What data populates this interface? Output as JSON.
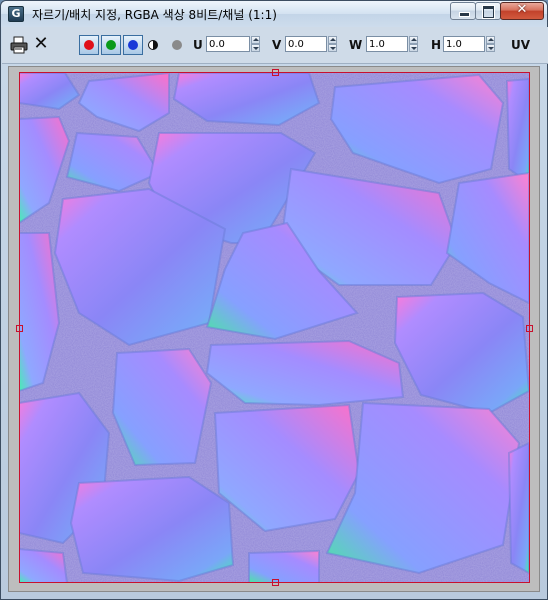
{
  "window": {
    "title": "자르기/배치 지정, RGBA 색상 8비트/채널 (1:1)",
    "app_icon_glyph": "G",
    "controls": {
      "minimize_icon": "minimize-icon",
      "maximize_icon": "maximize-icon",
      "close_icon": "close-icon",
      "close_glyph": "✕"
    }
  },
  "toolbar": {
    "print_icon": "print-icon",
    "clear_glyph": "✕",
    "channels": [
      {
        "name": "red-channel",
        "color": "#e0101a",
        "active": true
      },
      {
        "name": "green-channel",
        "color": "#0a9a1a",
        "active": true
      },
      {
        "name": "blue-channel",
        "color": "#1838d8",
        "active": true
      }
    ],
    "alpha_icon": "alpha-channel-icon",
    "mono_icon": "monochrome-icon",
    "u": {
      "label": "U",
      "value": "0.0"
    },
    "v": {
      "label": "V",
      "value": "0.0"
    },
    "w": {
      "label": "W",
      "value": "1.0"
    },
    "h": {
      "label": "H",
      "value": "1.0"
    },
    "uv_label": "UV"
  },
  "image": {
    "description_colors": {
      "base": "#8f86d6",
      "crop_frame": "#c8102e"
    }
  }
}
